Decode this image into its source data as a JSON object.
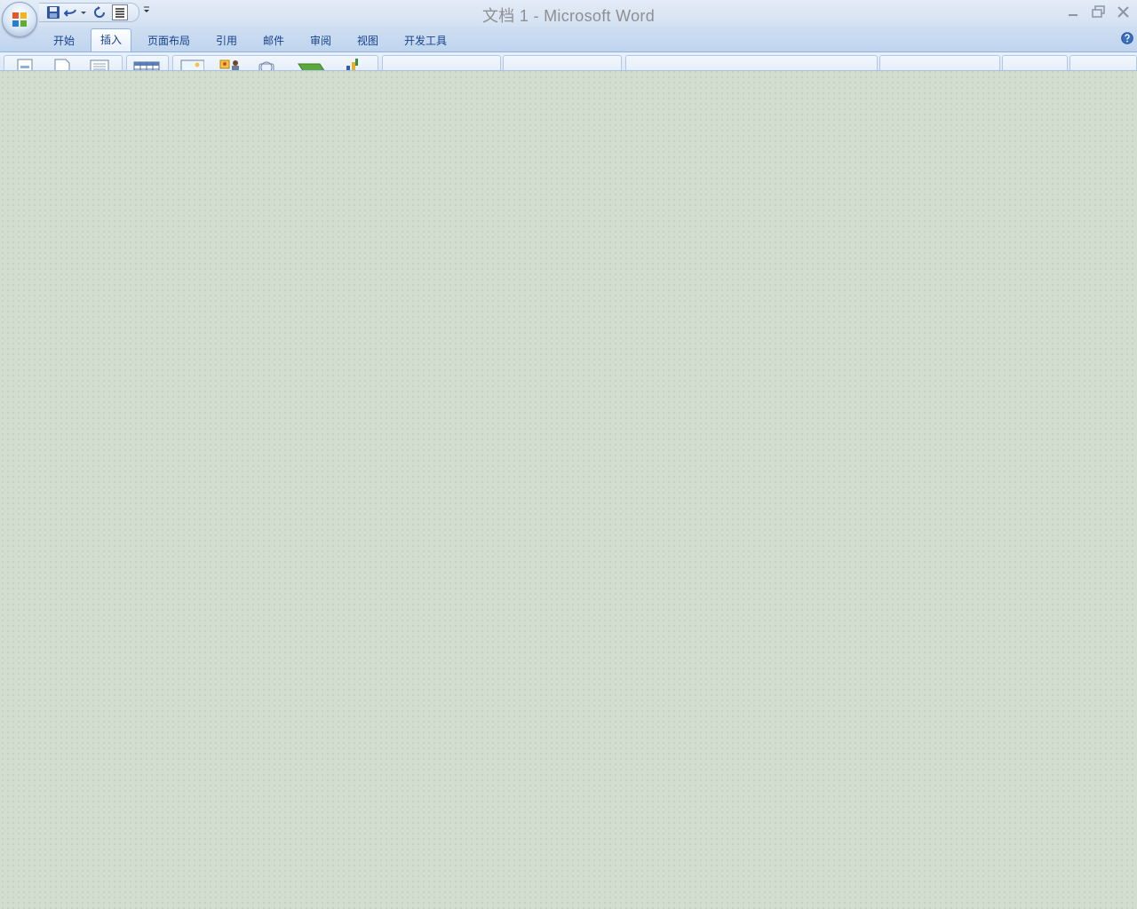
{
  "window": {
    "title": "文档 1 - Microsoft Word",
    "controls": [
      "minimize-icon",
      "restore-icon",
      "close-icon"
    ]
  },
  "quick_access": {
    "items": [
      "save-icon",
      "undo-icon",
      "undo-dropdown-icon",
      "redo-icon",
      "format-icon"
    ],
    "customize": "chevron-down-icon"
  },
  "ribbon": {
    "tabs": [
      {
        "label": "开始",
        "active": false
      },
      {
        "label": "插入",
        "active": true
      },
      {
        "label": "页面布局",
        "active": false
      },
      {
        "label": "引用",
        "active": false
      },
      {
        "label": "邮件",
        "active": false
      },
      {
        "label": "审阅",
        "active": false
      },
      {
        "label": "视图",
        "active": false
      },
      {
        "label": "开发工具",
        "active": false
      }
    ],
    "help": "help-icon"
  },
  "colors": {
    "accent": "#15428b",
    "ribbon_border": "#8db2e3",
    "workspace": "#d2ddd0"
  }
}
